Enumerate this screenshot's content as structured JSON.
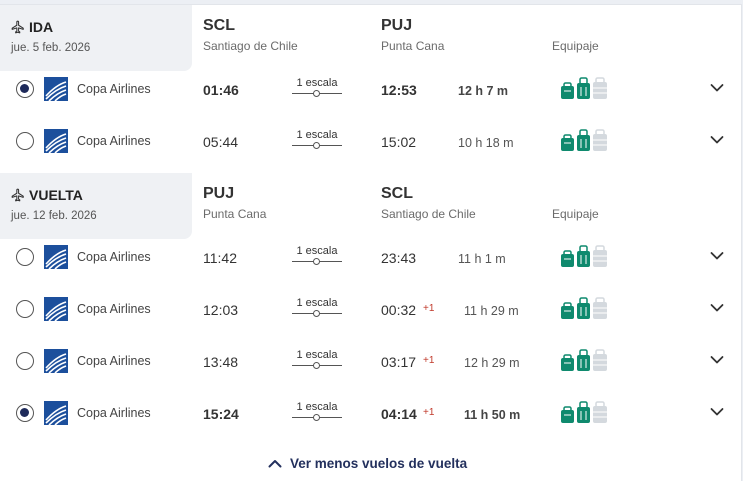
{
  "outbound": {
    "label": "IDA",
    "date": "jue. 5 feb. 2026",
    "origin_code": "SCL",
    "origin_city": "Santiago de Chile",
    "dest_code": "PUJ",
    "dest_city": "Punta Cana",
    "baggage_label": "Equipaje",
    "flights": [
      {
        "airline": "Copa Airlines",
        "dep": "01:46",
        "stops": "1 escala",
        "arr": "12:53",
        "day_offset": "",
        "duration": "12 h 7 m",
        "selected": true
      },
      {
        "airline": "Copa Airlines",
        "dep": "05:44",
        "stops": "1 escala",
        "arr": "15:02",
        "day_offset": "",
        "duration": "10 h 18 m",
        "selected": false
      }
    ]
  },
  "return": {
    "label": "VUELTA",
    "date": "jue. 12 feb. 2026",
    "origin_code": "PUJ",
    "origin_city": "Punta Cana",
    "dest_code": "SCL",
    "dest_city": "Santiago de Chile",
    "baggage_label": "Equipaje",
    "flights": [
      {
        "airline": "Copa Airlines",
        "dep": "11:42",
        "stops": "1 escala",
        "arr": "23:43",
        "day_offset": "",
        "duration": "11 h 1 m",
        "selected": false
      },
      {
        "airline": "Copa Airlines",
        "dep": "12:03",
        "stops": "1 escala",
        "arr": "00:32",
        "day_offset": "+1",
        "duration": "11 h 29 m",
        "selected": false
      },
      {
        "airline": "Copa Airlines",
        "dep": "13:48",
        "stops": "1 escala",
        "arr": "03:17",
        "day_offset": "+1",
        "duration": "12 h 29 m",
        "selected": false
      },
      {
        "airline": "Copa Airlines",
        "dep": "15:24",
        "stops": "1 escala",
        "arr": "04:14",
        "day_offset": "+1",
        "duration": "11 h 50 m",
        "selected": true
      }
    ]
  },
  "show_less_label": "Ver menos vuelos de vuelta",
  "colors": {
    "accent": "#1e2a5a",
    "baggage_included": "#0f8a6e",
    "baggage_excluded": "#d4d9de",
    "day_offset": "#c0392b"
  },
  "icons": {
    "direction": "plane-icon",
    "airline": "copa-airlines-logo",
    "baggage": [
      "personal-bag-icon",
      "carry-on-icon",
      "checked-bag-icon"
    ],
    "expand": "chevron-down-icon",
    "collapse": "chevron-up-icon"
  }
}
